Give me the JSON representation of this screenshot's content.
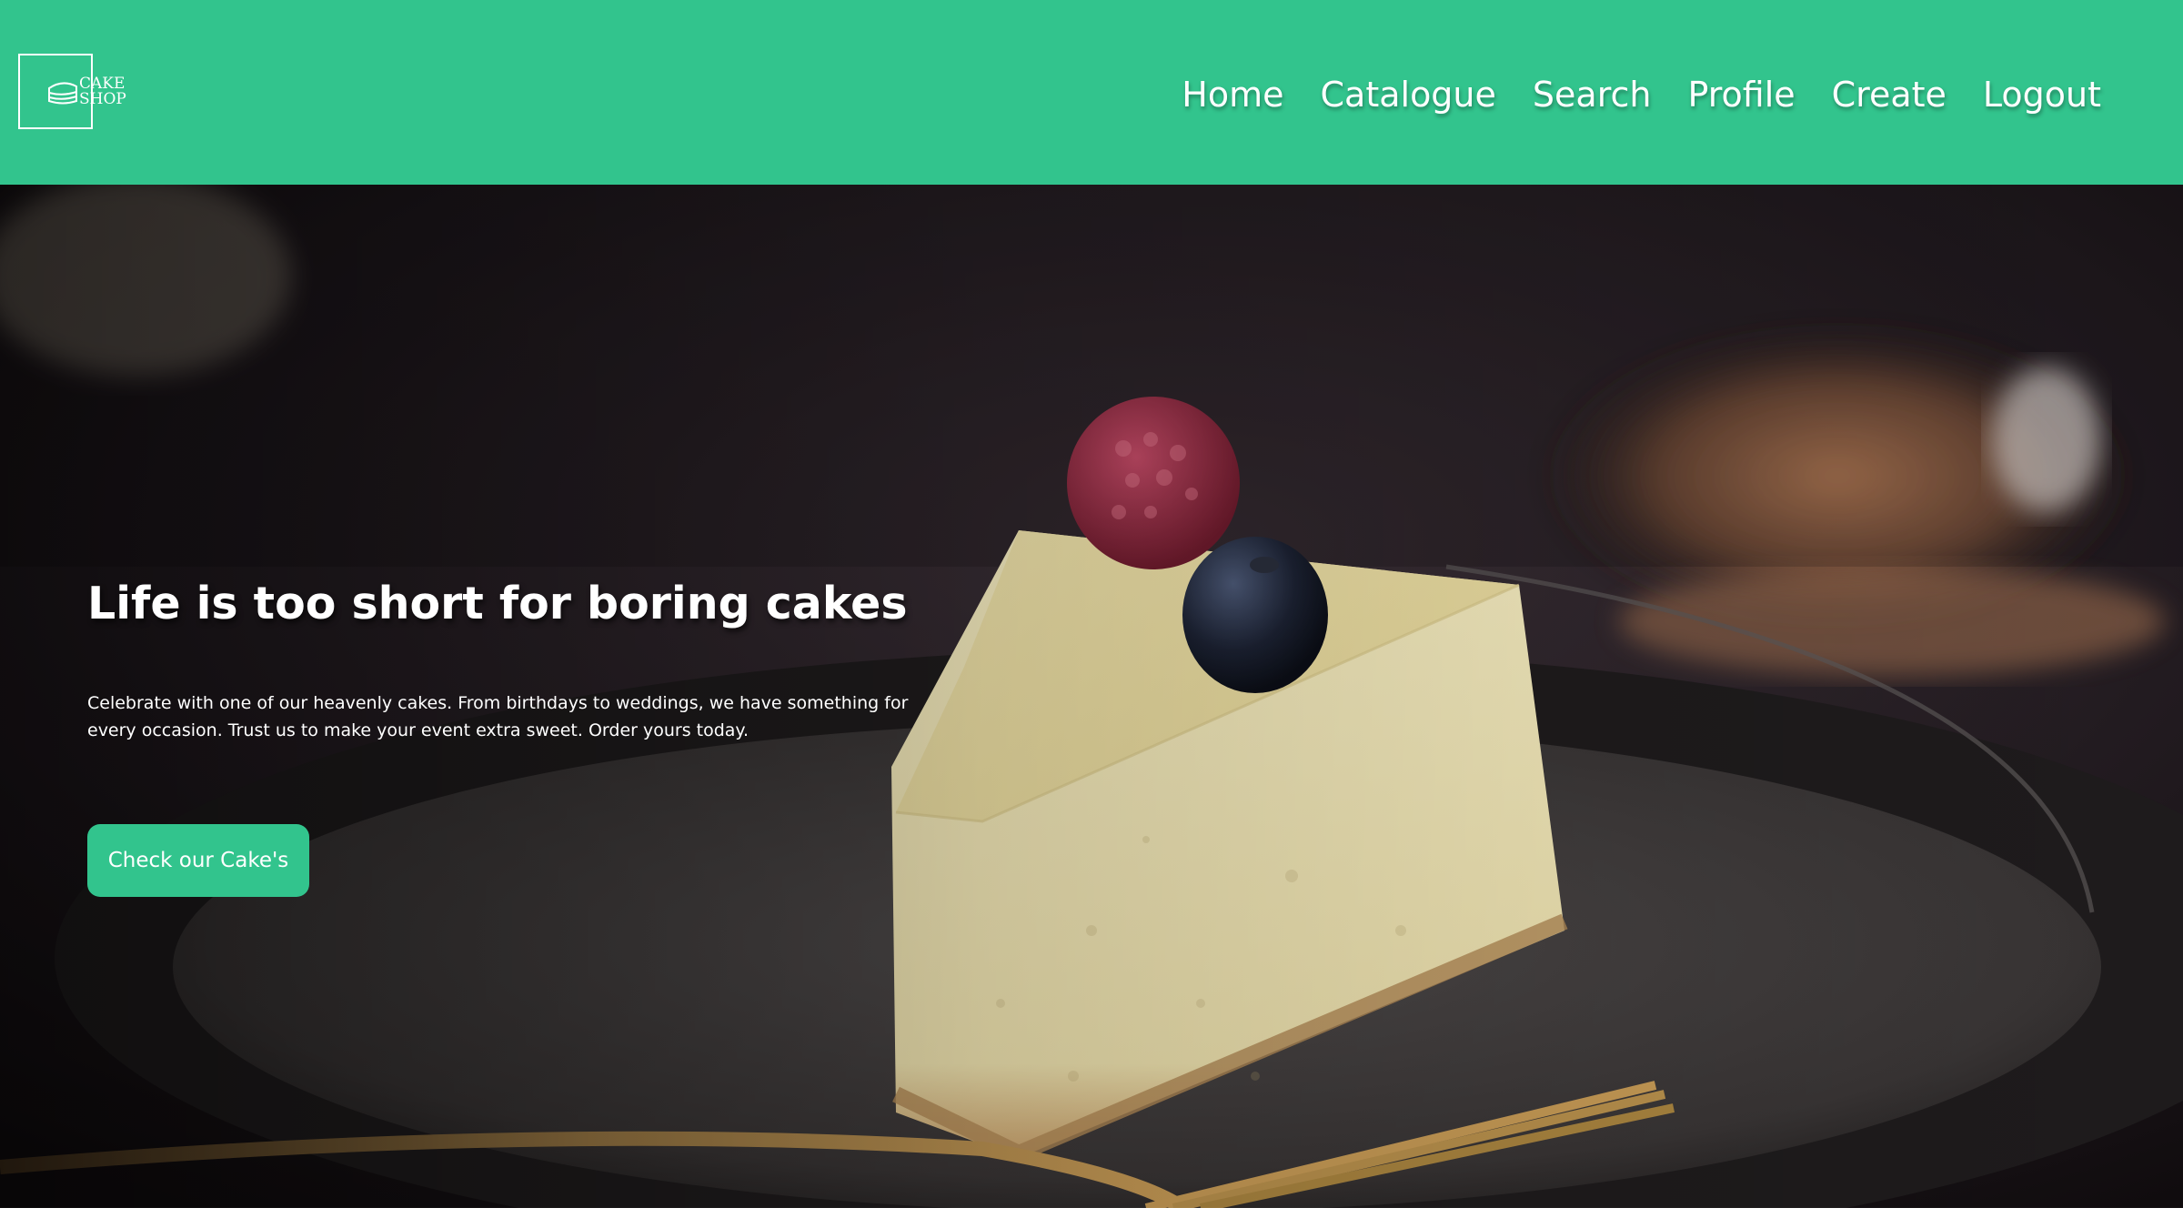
{
  "logo": {
    "line1": "CAKE",
    "line2": "SHOP"
  },
  "nav": [
    {
      "label": "Home"
    },
    {
      "label": "Catalogue"
    },
    {
      "label": "Search"
    },
    {
      "label": "Profile"
    },
    {
      "label": "Create"
    },
    {
      "label": "Logout"
    }
  ],
  "hero": {
    "headline": "Life is too short for boring cakes",
    "description": "Celebrate with one of our heavenly cakes. From birthdays to weddings, we have something for every occasion. Trust us to make your event extra sweet. Order yours today.",
    "cta_label": "Check our Cake's"
  },
  "colors": {
    "brand": "#32c48d",
    "text": "#ffffff"
  }
}
